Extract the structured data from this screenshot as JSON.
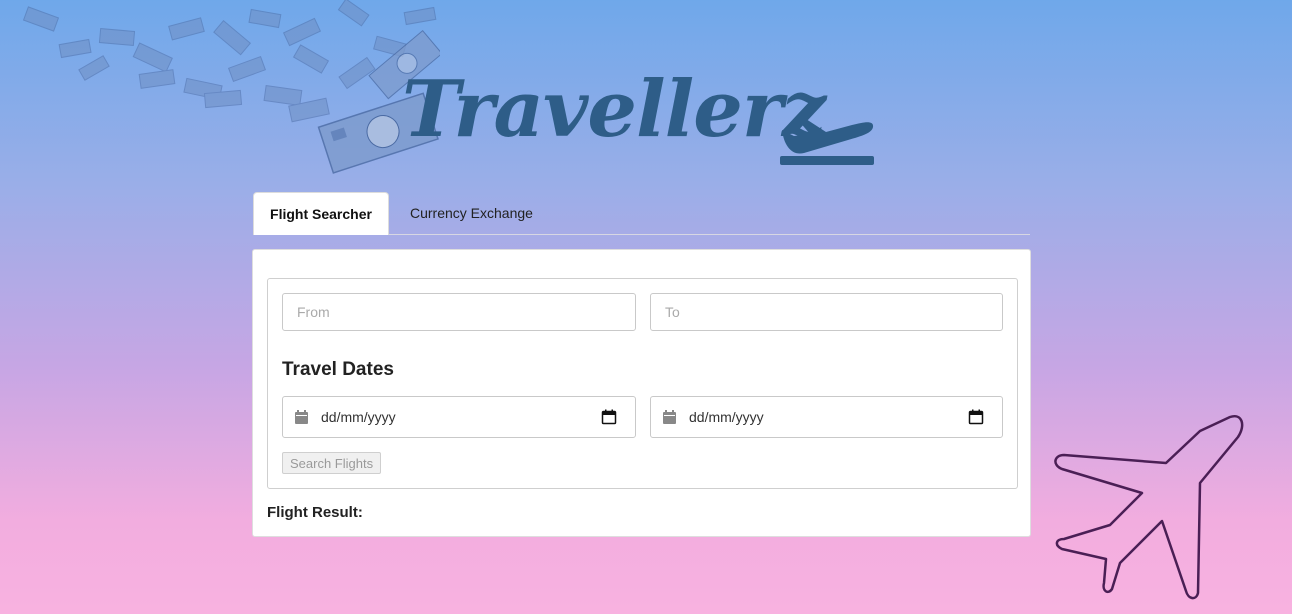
{
  "brand": {
    "logo_text": "Travellerz",
    "logo_color": "#2e5d88"
  },
  "tabs": [
    {
      "label": "Flight Searcher",
      "active": true
    },
    {
      "label": "Currency Exchange",
      "active": false
    }
  ],
  "form": {
    "from_placeholder": "From",
    "to_placeholder": "To",
    "dates_title": "Travel Dates",
    "depart_date_placeholder": "dd/mm/yyyy",
    "return_date_placeholder": "dd/mm/yyyy",
    "search_label": "Search Flights",
    "search_enabled": false
  },
  "results": {
    "label": "Flight Result:"
  },
  "icons": {
    "decor": [
      "money-bills-icon",
      "airplane-outline-icon"
    ],
    "logo": "plane-takeoff-icon",
    "date_fields": [
      "calendar-icon",
      "calendar-picker-icon"
    ]
  },
  "colors": {
    "bg_top": "#6fa8ea",
    "bg_bottom": "#f8b2e0",
    "logo": "#2e5d88",
    "panel": "#ffffff"
  }
}
